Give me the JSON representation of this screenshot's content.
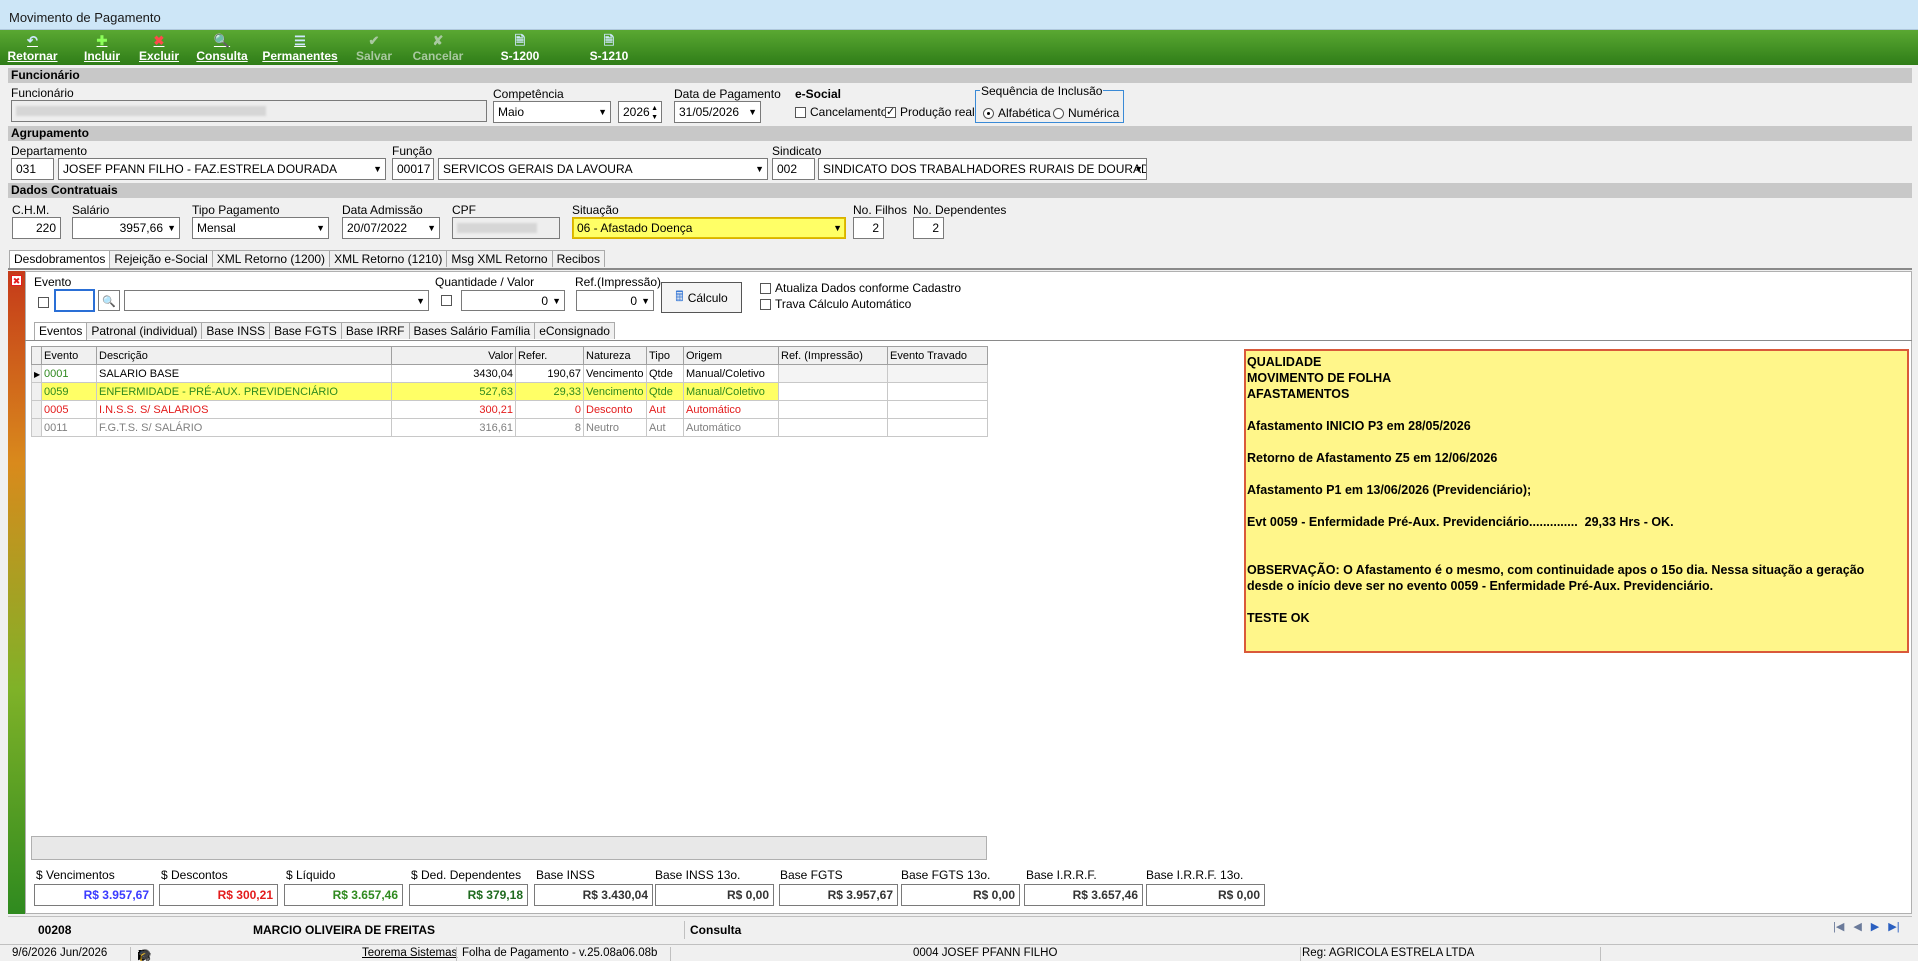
{
  "window": {
    "title": "Movimento de Pagamento"
  },
  "toolbar": [
    {
      "label": "Retornar",
      "icon": "return-icon",
      "enabled": true
    },
    {
      "label": "Incluir",
      "icon": "plus-icon",
      "enabled": true
    },
    {
      "label": "Excluir",
      "icon": "delete-icon",
      "enabled": true
    },
    {
      "label": "Consulta",
      "icon": "search-icon",
      "enabled": true
    },
    {
      "label": "Permanentes",
      "icon": "list-icon",
      "enabled": true
    },
    {
      "label": "Salvar",
      "icon": "check-icon",
      "enabled": false
    },
    {
      "label": "Cancelar",
      "icon": "cancel-icon",
      "enabled": false
    },
    {
      "label": "S-1200",
      "icon": "document-icon",
      "enabled": true
    },
    {
      "label": "S-1210",
      "icon": "document-icon",
      "enabled": true
    }
  ],
  "funcionario": {
    "section": "Funcionário",
    "label": "Funcionário",
    "competencia_label": "Competência",
    "competencia_mes": "Maio",
    "competencia_ano": "2026",
    "data_pagamento_label": "Data de Pagamento",
    "data_pagamento": "31/05/2026",
    "esocial_label": "e-Social",
    "cancelamento_label": "Cancelamento",
    "producao_real_label": "Produção real",
    "sequencia_label": "Sequência de Inclusão",
    "alfabetica_label": "Alfabética",
    "numerica_label": "Numérica"
  },
  "agrupamento": {
    "section": "Agrupamento",
    "departamento_label": "Departamento",
    "departamento_cod": "031",
    "departamento_nome": "JOSEF PFANN FILHO - FAZ.ESTRELA DOURADA",
    "funcao_label": "Função",
    "funcao_cod": "00017",
    "funcao_nome": "SERVICOS GERAIS DA LAVOURA",
    "sindicato_label": "Sindicato",
    "sindicato_cod": "002",
    "sindicato_nome": "SINDICATO DOS TRABALHADORES RURAIS DE DOURADOS"
  },
  "contratuais": {
    "section": "Dados Contratuais",
    "chm_label": "C.H.M.",
    "chm": "220",
    "salario_label": "Salário",
    "salario": "3957,66",
    "tipo_pag_label": "Tipo Pagamento",
    "tipo_pag": "Mensal",
    "admissao_label": "Data Admissão",
    "admissao": "20/07/2022",
    "cpf_label": "CPF",
    "situacao_label": "Situação",
    "situacao": "06 - Afastado Doença",
    "filhos_label": "No. Filhos",
    "filhos": "2",
    "dependentes_label": "No. Dependentes",
    "dependentes": "2"
  },
  "main_tabs": [
    "Desdobramentos",
    "Rejeição e-Social",
    "XML Retorno (1200)",
    "XML Retorno (1210)",
    "Msg XML Retorno",
    "Recibos"
  ],
  "evento_form": {
    "evento_label": "Evento",
    "qtd_label": "Quantidade / Valor",
    "qtd_value": "0",
    "ref_label": "Ref.(Impressão)",
    "ref_value": "0",
    "calculo_label": "Cálculo",
    "atualiza_label": "Atualiza Dados conforme Cadastro",
    "trava_label": "Trava Cálculo Automático"
  },
  "sub_tabs": [
    "Eventos",
    "Patronal (individual)",
    "Base INSS",
    "Base FGTS",
    "Base IRRF",
    "Bases Salário Família",
    "eConsignado"
  ],
  "grid": {
    "columns": [
      "Evento",
      "Descrição",
      "Valor",
      "Refer.",
      "Natureza",
      "Tipo",
      "Origem",
      "Ref. (Impressão)",
      "Evento Travado"
    ],
    "rows": [
      {
        "evento": "0001",
        "descricao": "SALARIO BASE",
        "valor": "3430,04",
        "refer": "190,67",
        "natureza": "Vencimento",
        "tipo": "Qtde",
        "origem": "Manual/Coletivo",
        "ref_imp": "",
        "travado": ""
      },
      {
        "evento": "0059",
        "descricao": "ENFERMIDADE - PRÉ-AUX. PREVIDENCIÁRIO",
        "valor": "527,63",
        "refer": "29,33",
        "natureza": "Vencimento",
        "tipo": "Qtde",
        "origem": "Manual/Coletivo",
        "ref_imp": "",
        "travado": ""
      },
      {
        "evento": "0005",
        "descricao": "I.N.S.S. S/ SALARIOS",
        "valor": "300,21",
        "refer": "0",
        "natureza": "Desconto",
        "tipo": "Aut",
        "origem": "Automático",
        "ref_imp": "",
        "travado": ""
      },
      {
        "evento": "0011",
        "descricao": "F.G.T.S. S/ SALÁRIO",
        "valor": "316,61",
        "refer": "8",
        "natureza": "Neutro",
        "tipo": "Aut",
        "origem": "Automático",
        "ref_imp": "",
        "travado": ""
      }
    ]
  },
  "note_lines": [
    "QUALIDADE",
    "MOVIMENTO DE FOLHA",
    "AFASTAMENTOS",
    "",
    "Afastamento INICIO P3 em 28/05/2026",
    "",
    "Retorno de Afastamento Z5 em 12/06/2026",
    "",
    "Afastamento P1 em 13/06/2026 (Previdenciário);",
    "",
    "Evt 0059 - Enfermidade Pré-Aux. Previdenciário..............  29,33 Hrs - OK.",
    "",
    "",
    "OBSERVAÇÃO: O Afastamento é o mesmo, com continuidade apos o 15o dia. Nessa situação a geração",
    "desde o início deve ser no evento 0059 - Enfermidade Pré-Aux. Previdenciário.",
    "",
    "TESTE OK"
  ],
  "totals": [
    {
      "label": "$ Vencimentos",
      "value": "R$ 3.957,67",
      "color": "#3a3aff"
    },
    {
      "label": "$ Descontos",
      "value": "R$ 300,21",
      "color": "#e31c1c"
    },
    {
      "label": "$ Líquido",
      "value": "R$ 3.657,46",
      "color": "#2f8a1f"
    },
    {
      "label": "$ Ded. Dependentes",
      "value": "R$ 379,18",
      "color": "#1f6a1f"
    },
    {
      "label": "Base INSS",
      "value": "R$ 3.430,04",
      "color": "#333333"
    },
    {
      "label": "Base INSS 13o.",
      "value": "R$ 0,00",
      "color": "#333333"
    },
    {
      "label": "Base FGTS",
      "value": "R$ 3.957,67",
      "color": "#333333"
    },
    {
      "label": "Base FGTS 13o.",
      "value": "R$ 0,00",
      "color": "#333333"
    },
    {
      "label": "Base I.R.R.F.",
      "value": "R$ 3.657,46",
      "color": "#333333"
    },
    {
      "label": "Base I.R.R.F. 13o.",
      "value": "R$ 0,00",
      "color": "#333333"
    }
  ],
  "footer": {
    "code": "00208",
    "name": "MARCIO OLIVEIRA DE FREITAS",
    "mode": "Consulta"
  },
  "statusbar": {
    "date": "9/6/2026 Jun/2026",
    "company_link": "Teorema Sistemas",
    "version": "Folha de Pagamento - v.25.08a06.08b",
    "employer": "0004 JOSEF PFANN FILHO",
    "reg": "Reg: AGRICOLA ESTRELA LTDA"
  },
  "colors": {
    "toolbar": "#3f8f22",
    "section_bar": "#c8c8c8",
    "highlight": "#ffff66",
    "note_bg": "#fff68a",
    "note_border": "#d9593a"
  }
}
